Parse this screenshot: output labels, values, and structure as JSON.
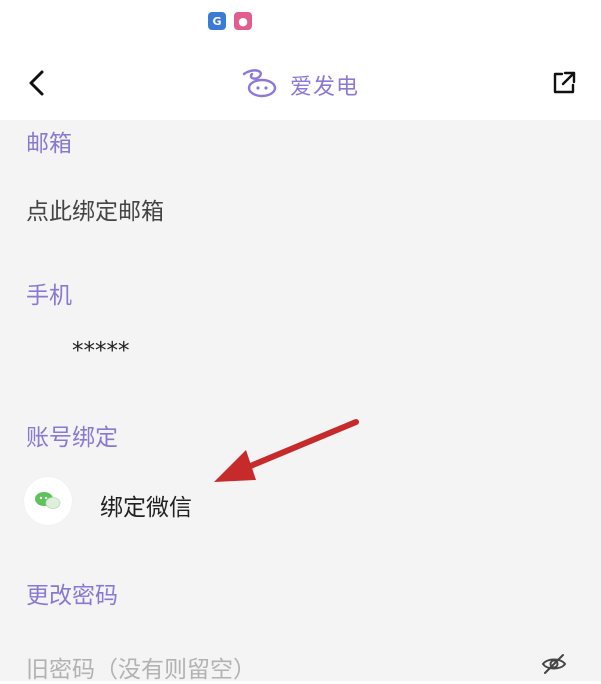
{
  "status_bar": {
    "icons": [
      "app-g-icon",
      "app-podcast-icon"
    ]
  },
  "nav": {
    "title": "爱发电",
    "back_icon": "chevron-left-icon",
    "share_icon": "external-link-icon"
  },
  "sections": {
    "email": {
      "title": "邮箱",
      "value": "点此绑定邮箱"
    },
    "phone": {
      "title": "手机",
      "value": "*****"
    },
    "account_binding": {
      "title": "账号绑定",
      "wechat_label": "绑定微信"
    },
    "change_password": {
      "title": "更改密码",
      "old_password_placeholder": "旧密码（没有则留空）"
    }
  },
  "colors": {
    "accent": "#8a78d2",
    "annotation_arrow": "#c62a2a",
    "wechat_green": "#5ec25a",
    "background": "#f4f4f4"
  }
}
